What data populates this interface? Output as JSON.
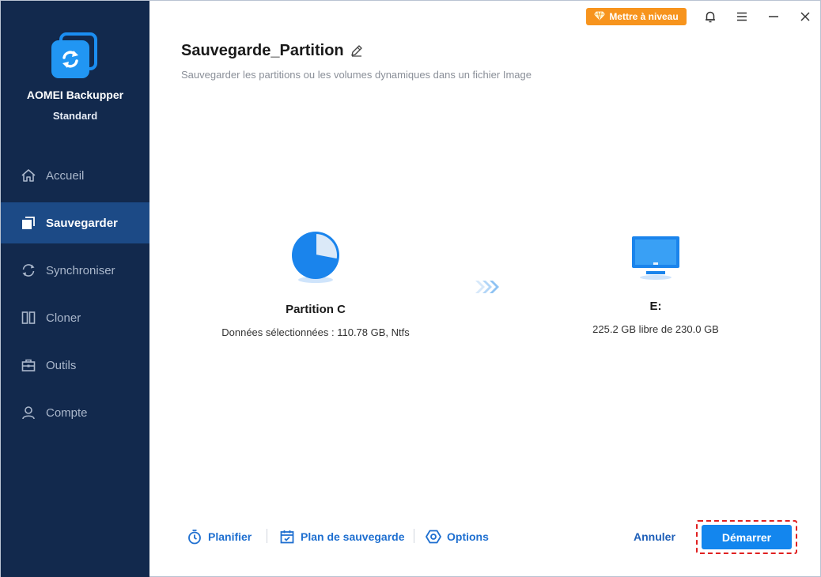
{
  "app": {
    "name": "AOMEI Backupper",
    "edition": "Standard"
  },
  "sidebar": {
    "items": [
      {
        "label": "Accueil",
        "icon": "home-icon"
      },
      {
        "label": "Sauvegarder",
        "icon": "backup-icon",
        "active": true
      },
      {
        "label": "Synchroniser",
        "icon": "sync-icon"
      },
      {
        "label": "Cloner",
        "icon": "clone-icon"
      },
      {
        "label": "Outils",
        "icon": "toolbox-icon"
      },
      {
        "label": "Compte",
        "icon": "user-icon"
      }
    ]
  },
  "topbar": {
    "upgrade_label": "Mettre à niveau",
    "icons": [
      "bell-icon",
      "menu-icon",
      "minimize-icon",
      "close-icon"
    ]
  },
  "header": {
    "title": "Sauvegarde_Partition",
    "subtitle": "Sauvegarder les partitions ou les volumes dynamiques dans un fichier Image"
  },
  "source": {
    "label": "Partition C",
    "detail": "Données sélectionnées : 110.78 GB, Ntfs",
    "used_fraction": 0.28
  },
  "destination": {
    "label": "E:",
    "detail": "225.2 GB libre de 230.0 GB"
  },
  "toolbar": {
    "schedule_label": "Planifier",
    "plan_label": "Plan de sauvegarde",
    "options_label": "Options",
    "cancel_label": "Annuler",
    "start_label": "Démarrer"
  },
  "colors": {
    "sidebar_bg": "#12294d",
    "sidebar_active": "#1c4a86",
    "accent": "#1386ee",
    "upgrade": "#f7941d",
    "highlight_border": "#e02020"
  }
}
